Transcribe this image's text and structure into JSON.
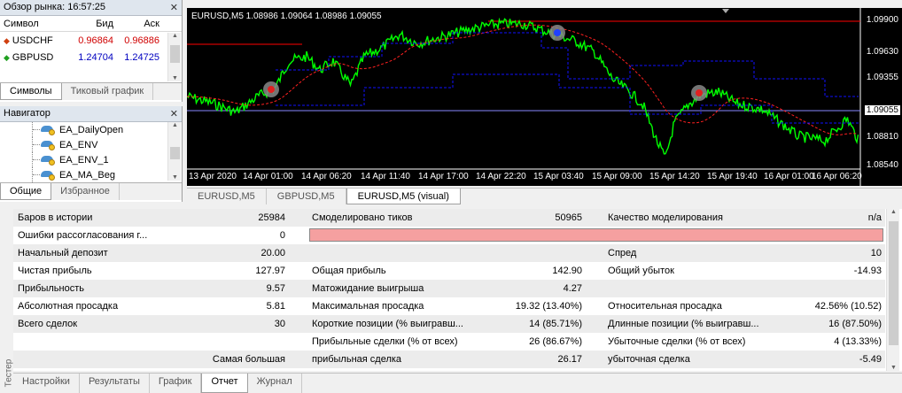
{
  "market_watch": {
    "title": "Обзор рынка: 16:57:25",
    "columns": {
      "symbol": "Символ",
      "bid": "Бид",
      "ask": "Аск"
    },
    "rows": [
      {
        "symbol": "USDCHF",
        "bid": "0.96864",
        "ask": "0.96886",
        "direction": "down",
        "color": "#d00000"
      },
      {
        "symbol": "GBPUSD",
        "bid": "1.24704",
        "ask": "1.24725",
        "direction": "up",
        "color": "#0000c0"
      }
    ],
    "tabs": [
      "Символы",
      "Тиковый график"
    ]
  },
  "navigator": {
    "title": "Навигатор",
    "items": [
      "EA_DailyOpen",
      "EA_ENV",
      "EA_ENV_1",
      "EA_MA_Beg"
    ],
    "tabs": [
      "Общие",
      "Избранное"
    ]
  },
  "chart": {
    "title": "EURUSD,M5  1.08986 1.09064 1.08986 1.09055",
    "current_price": "1.09055",
    "price_labels": [
      "1.09900",
      "1.09630",
      "1.09355",
      "1.08810",
      "1.08540"
    ],
    "time_labels": [
      "13 Apr 2020",
      "14 Apr 01:00",
      "14 Apr 06:20",
      "14 Apr 11:40",
      "14 Apr 17:00",
      "14 Apr 22:20",
      "15 Apr 03:40",
      "15 Apr 09:00",
      "15 Apr 14:20",
      "15 Apr 19:40",
      "16 Apr 01:00",
      "16 Apr 06:20"
    ],
    "colors": {
      "price": "#00ff00",
      "envelope": "#1010ff",
      "ma": "#ff2020",
      "level": "#ff0000",
      "current": "#8888ff"
    }
  },
  "chart_tabs": [
    "EURUSD,M5",
    "GBPUSD,M5",
    "EURUSD,M5 (visual)"
  ],
  "report": {
    "rows": [
      {
        "l1": "Баров в истории",
        "v1": "25984",
        "l2": "Смоделировано тиков",
        "v2": "50965",
        "l3": "Качество моделирования",
        "v3": "n/a"
      },
      {
        "l1": "Ошибки рассогласования г...",
        "v1": "0",
        "l2": "",
        "v2": "",
        "l3": "",
        "v3": ""
      },
      {
        "l1": "Начальный депозит",
        "v1": "20.00",
        "l2": "",
        "v2": "",
        "l3": "Спред",
        "v3": "10"
      },
      {
        "l1": "Чистая прибыль",
        "v1": "127.97",
        "l2": "Общая прибыль",
        "v2": "142.90",
        "l3": "Общий убыток",
        "v3": "-14.93"
      },
      {
        "l1": "Прибыльность",
        "v1": "9.57",
        "l2": "Матожидание выигрыша",
        "v2": "4.27",
        "l3": "",
        "v3": ""
      },
      {
        "l1": "Абсолютная просадка",
        "v1": "5.81",
        "l2": "Максимальная просадка",
        "v2": "19.32 (13.40%)",
        "l3": "Относительная просадка",
        "v3": "42.56% (10.52)"
      },
      {
        "l1": "Всего сделок",
        "v1": "30",
        "l2": "Короткие позиции (% выигравш...",
        "v2": "14 (85.71%)",
        "l3": "Длинные позиции (% выигравш...",
        "v3": "16 (87.50%)"
      },
      {
        "l1": "",
        "v1": "",
        "l2": "Прибыльные сделки (% от всех)",
        "v2": "26 (86.67%)",
        "l3": "Убыточные сделки (% от всех)",
        "v3": "4 (13.33%)"
      },
      {
        "l1": "",
        "v1": "Самая большая",
        "l2": "прибыльная сделка",
        "v2": "26.17",
        "l3": "убыточная сделка",
        "v3": "-5.49"
      }
    ]
  },
  "tester_label": "Тестер",
  "bottom_tabs": [
    "Настройки",
    "Результаты",
    "График",
    "Отчет",
    "Журнал"
  ]
}
